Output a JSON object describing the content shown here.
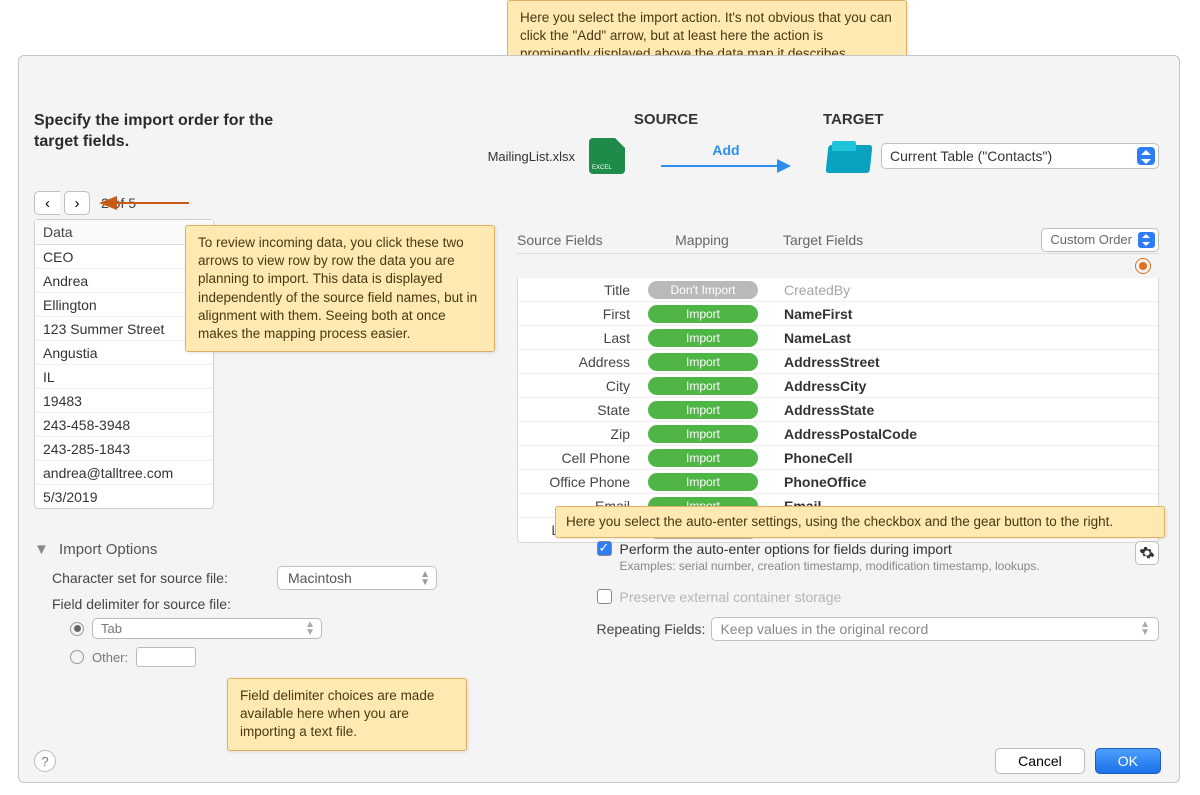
{
  "dialog": {
    "instruction": "Specify the import order for the target fields.",
    "pager": {
      "position": "2 of 5"
    },
    "source": {
      "label": "SOURCE",
      "filename": "MailingList.xlsx",
      "action": "Add"
    },
    "target": {
      "label": "TARGET",
      "current": "Current Table (\"Contacts\")"
    },
    "preview": {
      "header": "Data",
      "rows": [
        "CEO",
        "Andrea",
        "Ellington",
        "123 Summer Street",
        "Angustia",
        "IL",
        "19483",
        "243-458-3948",
        "243-285-1843",
        "andrea@talltree.com",
        "5/3/2019"
      ]
    },
    "mapping": {
      "headers": {
        "source": "Source Fields",
        "mapping": "Mapping",
        "target": "Target Fields"
      },
      "order": "Custom Order",
      "rows": [
        {
          "src": "Title",
          "map": "skip",
          "target": "CreatedBy",
          "dim": true
        },
        {
          "src": "First",
          "map": "import",
          "target": "NameFirst"
        },
        {
          "src": "Last",
          "map": "import",
          "target": "NameLast"
        },
        {
          "src": "Address",
          "map": "import",
          "target": "AddressStreet"
        },
        {
          "src": "City",
          "map": "import",
          "target": "AddressCity"
        },
        {
          "src": "State",
          "map": "import",
          "target": "AddressState"
        },
        {
          "src": "Zip",
          "map": "import",
          "target": "AddressPostalCode"
        },
        {
          "src": "Cell Phone",
          "map": "import",
          "target": "PhoneCell"
        },
        {
          "src": "Office Phone",
          "map": "import",
          "target": "PhoneOffice"
        },
        {
          "src": "Email",
          "map": "import",
          "target": "Email"
        },
        {
          "src": "Last Contact",
          "map": "skip",
          "target": ""
        }
      ],
      "labels": {
        "import": "Import",
        "skip": "Don't Import"
      }
    },
    "options": {
      "title": "Import Options",
      "charset_label": "Character set for source file:",
      "charset_value": "Macintosh",
      "delimiter_label": "Field delimiter for source file:",
      "delimiter_tab": "Tab",
      "delimiter_other": "Other:",
      "auto_enter": "Perform the auto-enter options for fields during import",
      "auto_enter_examples": "Examples: serial number, creation timestamp, modification timestamp, lookups.",
      "preserve": "Preserve external container storage",
      "repeating_label": "Repeating Fields:",
      "repeating_value": "Keep values in the original record"
    },
    "footer": {
      "cancel": "Cancel",
      "ok": "OK"
    }
  },
  "annotations": {
    "top": "Here you select the import action. It's not obvious that you can click the \"Add\" arrow, but at least here the action is prominently displayed above the data map it describes.",
    "preview": "To review incoming data, you click these two arrows to view row by row the data you are planning to import. This data is displayed independently of the source field names, but in alignment with them. Seeing both at once makes the mapping process easier.",
    "autoenter": "Here you select the auto-enter settings, using the checkbox and the gear button to the right.",
    "delimiter": "Field delimiter choices are made available here when you are importing a text file."
  }
}
